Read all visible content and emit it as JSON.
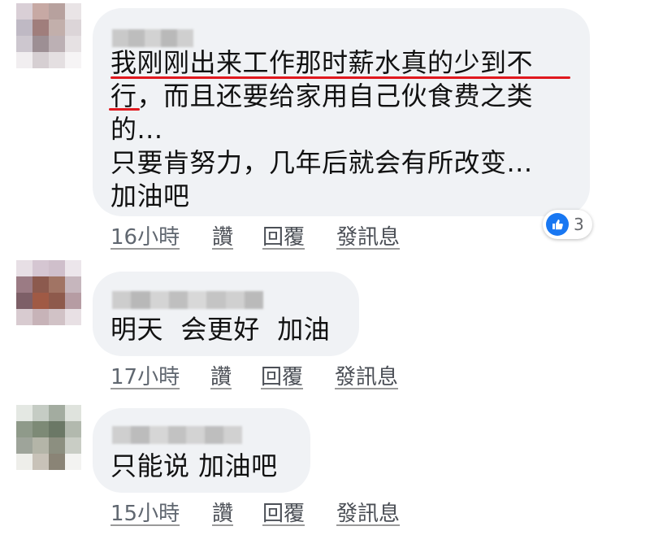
{
  "comments": [
    {
      "text_lines": [
        "我刚刚出来工作那时薪水真的少到不",
        "行，而且还要给家用自己伙食费之类",
        "的...",
        "只要肯努力，几年后就会有所改变...",
        "加油吧"
      ],
      "time": "16小時",
      "like_label": "讚",
      "reply_label": "回覆",
      "message_label": "發訊息",
      "reaction_count": "3",
      "reaction_icon": "like-icon",
      "highlight_color": "#e0181e"
    },
    {
      "text_lines": [
        "明天  会更好  加油"
      ],
      "time": "17小時",
      "like_label": "讚",
      "reply_label": "回覆",
      "message_label": "發訊息"
    },
    {
      "text_lines": [
        "只能说 加油吧"
      ],
      "time": "15小時",
      "like_label": "讚",
      "reply_label": "回覆",
      "message_label": "發訊息"
    }
  ],
  "colors": {
    "bubble": "#f0f2f5",
    "reaction_blue": "#1877f2"
  }
}
